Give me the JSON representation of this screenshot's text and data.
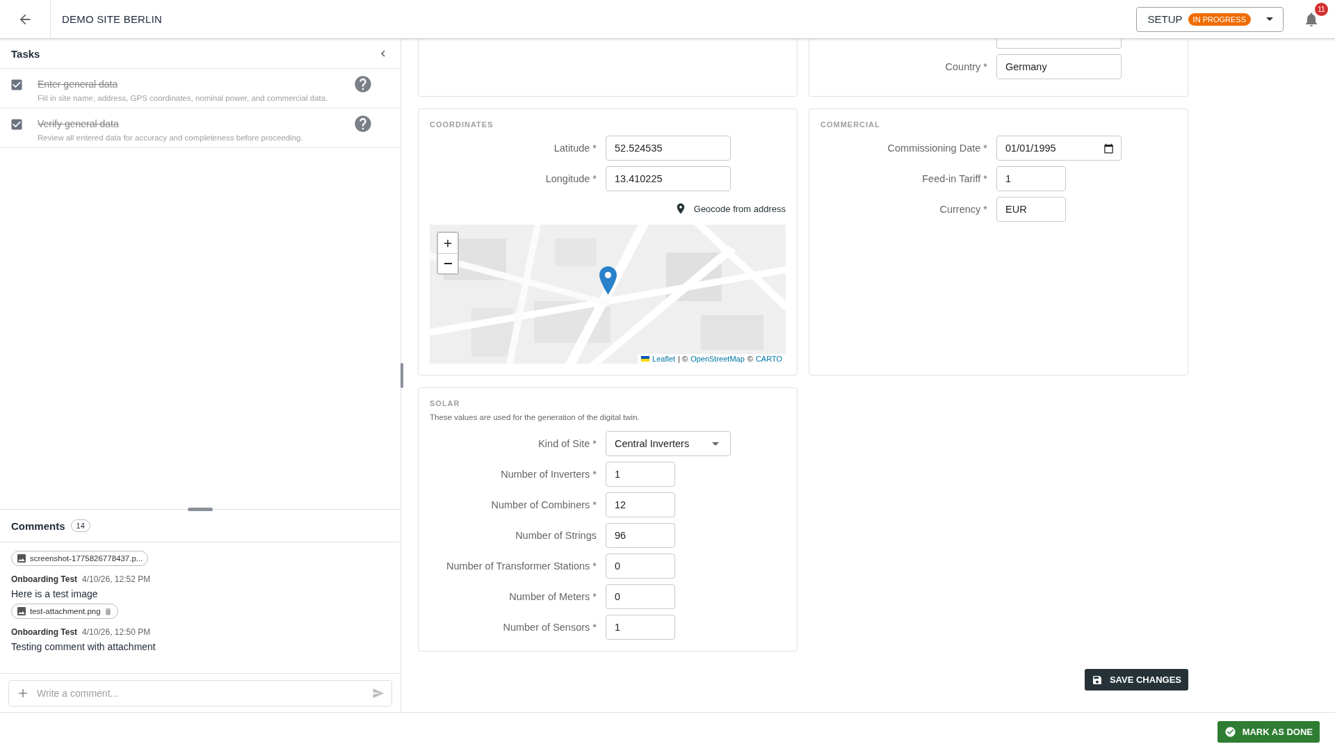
{
  "header": {
    "title": "DEMO SITE BERLIN",
    "status_button": {
      "label": "SETUP",
      "badge": "IN PROGRESS"
    },
    "notifications": {
      "count": "11"
    }
  },
  "tasks": {
    "title": "Tasks",
    "items": [
      {
        "title": "Enter general data",
        "description": "Fill in site name, address, GPS coordinates, nominal power, and commercial data.",
        "checked": true
      },
      {
        "title": "Verify general data",
        "description": "Review all entered data for accuracy and completeness before proceeding.",
        "checked": true
      }
    ]
  },
  "comments": {
    "title": "Comments",
    "count": "14",
    "entries": [
      {
        "attachments": [
          {
            "name": "screenshot-1775826778437.p...",
            "deletable": false
          }
        ]
      },
      {
        "author": "Onboarding Test",
        "time": "4/10/26, 12:52 PM",
        "text": "Here is a test image",
        "attachments": [
          {
            "name": "test-attachment.png",
            "deletable": true
          }
        ]
      },
      {
        "author": "Onboarding Test",
        "time": "4/10/26, 12:50 PM",
        "text": "Testing comment with attachment"
      }
    ],
    "input": {
      "placeholder": "Write a comment..."
    }
  },
  "sections": [
    {
      "kind": "cut"
    },
    {
      "kind": "cut",
      "fields": [
        {
          "kind": "stub"
        },
        {
          "kind": "text",
          "label": "Country *",
          "value": "Germany"
        }
      ]
    },
    {
      "kind": "card",
      "title": "COORDINATES",
      "fields": [
        {
          "kind": "text",
          "label": "Latitude *",
          "value": "52.524535"
        },
        {
          "kind": "text",
          "label": "Longitude *",
          "value": "13.410225"
        }
      ],
      "geocode_link": "Geocode from address",
      "map": {
        "attribution": [
          {
            "kind": "link",
            "text": "Leaflet"
          },
          {
            "kind": "text",
            "text": "| ©"
          },
          {
            "kind": "link",
            "text": "OpenStreetMap"
          },
          {
            "kind": "text",
            "text": "©"
          },
          {
            "kind": "link",
            "text": "CARTO"
          }
        ]
      }
    },
    {
      "kind": "card",
      "title": "COMMERCIAL",
      "fields": [
        {
          "kind": "date",
          "label": "Commissioning Date *",
          "value": "01/01/1995"
        },
        {
          "kind": "short",
          "label": "Feed-in Tariff *",
          "value": "1"
        },
        {
          "kind": "short",
          "label": "Currency *",
          "value": "EUR"
        }
      ]
    },
    {
      "kind": "card",
      "title": "SOLAR",
      "description": "These values are used for the generation of the digital twin.",
      "fields": [
        {
          "kind": "select",
          "label": "Kind of Site *",
          "value": "Central Inverters"
        },
        {
          "kind": "short",
          "label": "Number of Inverters *",
          "value": "1"
        },
        {
          "kind": "short",
          "label": "Number of Combiners *",
          "value": "12"
        },
        {
          "kind": "short",
          "label": "Number of Strings",
          "value": "96"
        },
        {
          "kind": "short",
          "label": "Number of Transformer Stations *",
          "value": "0"
        },
        {
          "kind": "short",
          "label": "Number of Meters *",
          "value": "0"
        },
        {
          "kind": "short",
          "label": "Number of Sensors *",
          "value": "1"
        }
      ]
    }
  ],
  "save_button": "SAVE CHANGES",
  "done_button": "MARK AS DONE"
}
